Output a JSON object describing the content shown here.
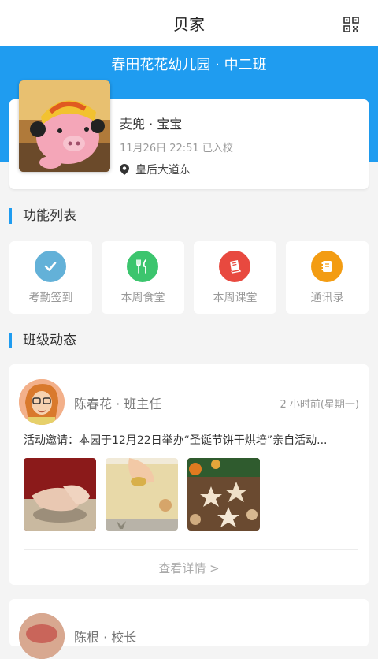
{
  "navbar": {
    "title": "贝家",
    "qr_icon": "qr-code-icon"
  },
  "header": {
    "class_name": "春田花花幼儿园 · 中二班"
  },
  "profile": {
    "child_name": "麦兜 · 宝宝",
    "enroll_time": "11月26日 22:51 已入校",
    "location": "皇后大道东",
    "location_icon": "map-pin-icon"
  },
  "functions": {
    "section_title": "功能列表",
    "items": [
      {
        "label": "考勤签到",
        "icon": "check-icon",
        "color": "#63b1d8"
      },
      {
        "label": "本周食堂",
        "icon": "fork-knife-icon",
        "color": "#3cc56e"
      },
      {
        "label": "本周课堂",
        "icon": "book-icon",
        "color": "#e8493f"
      },
      {
        "label": "通讯录",
        "icon": "contacts-icon",
        "color": "#f39c12"
      }
    ]
  },
  "feed": {
    "section_title": "班级动态",
    "posts": [
      {
        "author": "陈春花 · 班主任",
        "time": "2 小时前(星期一)",
        "text": "活动邀请：本园于12月22日举办“圣诞节饼干烘培”亲自活动...",
        "photos": [
          "cookie-dough-photo",
          "cookie-cutting-photo",
          "star-cookies-photo"
        ],
        "details": "查看详情 >"
      },
      {
        "author": "陈根 · 校长"
      }
    ]
  },
  "colors": {
    "accent": "#1f9cf0",
    "background": "#f4f4f4"
  }
}
